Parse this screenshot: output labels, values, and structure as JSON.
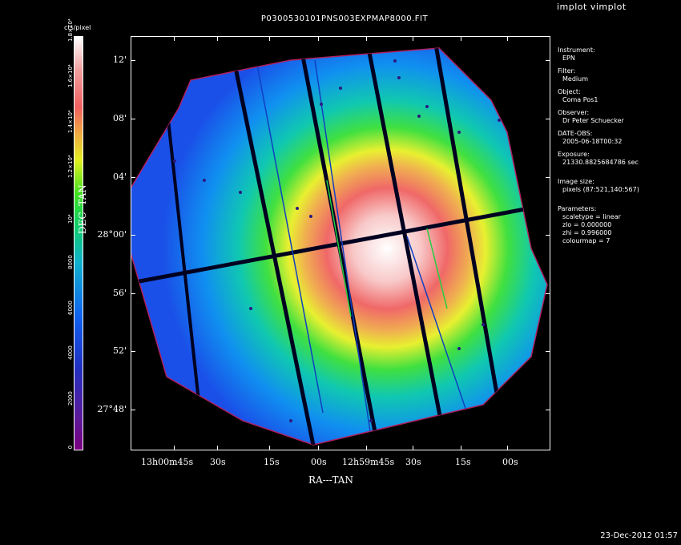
{
  "app_title": "implot vimplot",
  "plot_title": "P0300530101PNS003EXPMAP8000.FIT",
  "timestamp": "23-Dec-2012 01:57",
  "colorbar": {
    "unit": "cts/pixel",
    "ticks": [
      "0",
      "2000",
      "4000",
      "6000",
      "8000",
      "10⁴",
      "1.2×10⁴",
      "1.4×10⁴",
      "1.6×10⁴",
      "1.8×10⁴"
    ]
  },
  "axes": {
    "y_title": "DEC--TAN",
    "x_title": "RA---TAN",
    "y_ticks": [
      "12'",
      "08'",
      "04'",
      "28°00'",
      "56'",
      "52'",
      "27°48'"
    ],
    "x_ticks": [
      "13h00m45s",
      "30s",
      "15s",
      "00s",
      "12h59m45s",
      "30s",
      "15s",
      "00s"
    ]
  },
  "info": {
    "instrument_label": "Instrument:",
    "instrument": "EPN",
    "filter_label": "Filter:",
    "filter": "Medium",
    "object_label": "Object:",
    "object": "Coma Pos1",
    "observer_label": "Observer:",
    "observer": "Dr Peter Schuecker",
    "date_label": "DATE-OBS:",
    "date": "2005-06-18T00:32",
    "exposure_label": "Exposure:",
    "exposure": "21330.8825684786 sec",
    "image_size_label": "Image size:",
    "image_size": "pixels (87:521,140:567)",
    "parameters_label": "Parameters:",
    "scaletype": "scaletype = linear",
    "zlo": "zlo = 0.000000",
    "zhi": "zhi = 0.996000",
    "colourmap": "colourmap = 7"
  },
  "colors": {
    "background": "#000000",
    "edge": "#20a0ff",
    "center": "#ffffff"
  }
}
